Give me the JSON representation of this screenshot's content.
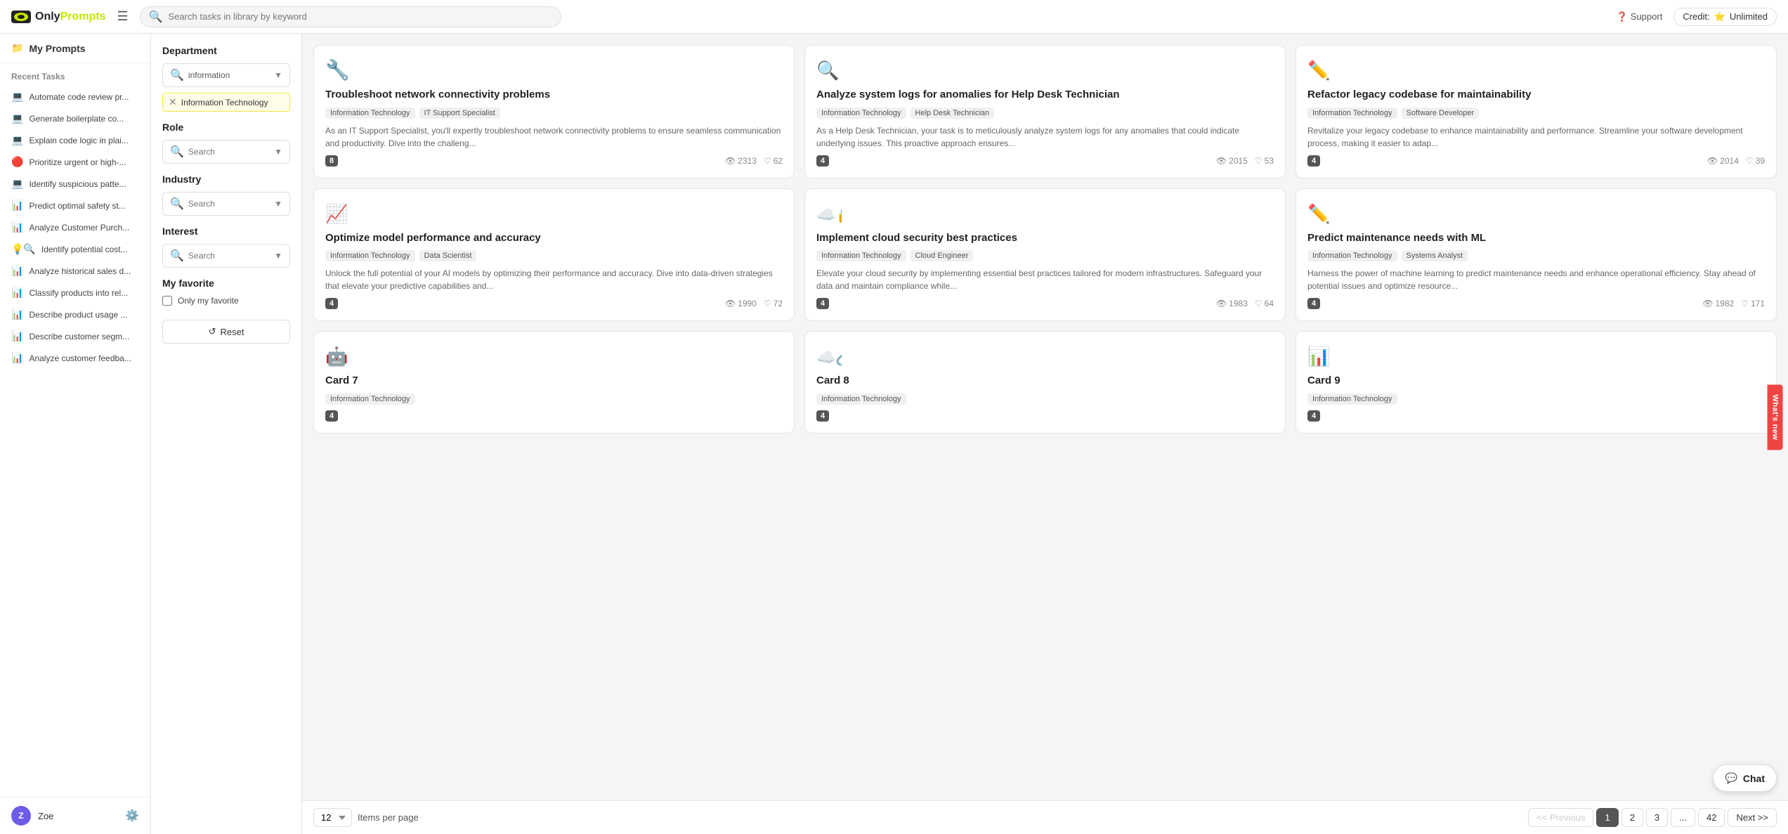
{
  "header": {
    "logo_text_1": "Only",
    "logo_text_2": "Prompts",
    "hamburger_label": "☰",
    "search_placeholder": "Search tasks in library by keyword",
    "support_label": "Support",
    "credit_label": "Credit:",
    "credit_value": "Unlimited"
  },
  "sidebar": {
    "my_prompts_label": "My Prompts",
    "recent_tasks_title": "Recent Tasks",
    "items": [
      {
        "label": "Automate code review pr...",
        "icon": "💻"
      },
      {
        "label": "Generate boilerplate co...",
        "icon": "💻"
      },
      {
        "label": "Explain code logic in plai...",
        "icon": "💻"
      },
      {
        "label": "Prioritize urgent or high-...",
        "icon": "🔴"
      },
      {
        "label": "Identify suspicious patte...",
        "icon": "💻"
      },
      {
        "label": "Predict optimal safety st...",
        "icon": "📊"
      },
      {
        "label": "Analyze Customer Purch...",
        "icon": "📊"
      },
      {
        "label": "Identify potential cost...",
        "icon": "💡🔍"
      },
      {
        "label": "Analyze historical sales d...",
        "icon": "📊"
      },
      {
        "label": "Classify products into rel...",
        "icon": "📊"
      },
      {
        "label": "Describe product usage ...",
        "icon": "📊"
      },
      {
        "label": "Describe customer segm...",
        "icon": "📊"
      },
      {
        "label": "Analyze customer feedba...",
        "icon": "📊"
      }
    ],
    "user_name": "Zoe",
    "user_avatar": "Z"
  },
  "filters": {
    "department_title": "Department",
    "department_search_placeholder": "information",
    "department_tag": "Information Technology",
    "role_title": "Role",
    "role_search_placeholder": "Search",
    "industry_title": "Industry",
    "industry_search_placeholder": "Search",
    "interest_title": "Interest",
    "interest_search_placeholder": "Search",
    "my_favorite_title": "My favorite",
    "my_favorite_checkbox": "Only my favorite",
    "reset_label": "Reset"
  },
  "cards": [
    {
      "id": 1,
      "icon": "🔧",
      "title": "Troubleshoot network connectivity problems",
      "tags": [
        "Information Technology",
        "IT Support Specialist"
      ],
      "description": "As an IT Support Specialist, you'll expertly troubleshoot network connectivity problems to ensure seamless communication and productivity. Dive into the challeng...",
      "badge": "8",
      "views": "2313",
      "likes": "62"
    },
    {
      "id": 2,
      "icon": "🔍",
      "title": "Analyze system logs for anomalies for Help Desk Technician",
      "tags": [
        "Information Technology",
        "Help Desk Technician"
      ],
      "description": "As a Help Desk Technician, your task is to meticulously analyze system logs for any anomalies that could indicate underlying issues. This proactive approach ensures...",
      "badge": "4",
      "views": "2015",
      "likes": "53"
    },
    {
      "id": 3,
      "icon": "✏️",
      "title": "Refactor legacy codebase for maintainability",
      "tags": [
        "Information Technology",
        "Software Developer"
      ],
      "description": "Revitalize your legacy codebase to enhance maintainability and performance. Streamline your software development process, making it easier to adap...",
      "badge": "4",
      "views": "2014",
      "likes": "39"
    },
    {
      "id": 4,
      "icon": "📈",
      "title": "Optimize model performance and accuracy",
      "tags": [
        "Information Technology",
        "Data Scientist"
      ],
      "description": "Unlock the full potential of your AI models by optimizing their performance and accuracy. Dive into data-driven strategies that elevate your predictive capabilities and...",
      "badge": "4",
      "views": "1990",
      "likes": "72"
    },
    {
      "id": 5,
      "icon": "☁️🔒",
      "title": "Implement cloud security best practices",
      "tags": [
        "Information Technology",
        "Cloud Engineer"
      ],
      "description": "Elevate your cloud security by implementing essential best practices tailored for modern infrastructures. Safeguard your data and maintain compliance while...",
      "badge": "4",
      "views": "1983",
      "likes": "64"
    },
    {
      "id": 6,
      "icon": "✏️",
      "title": "Predict maintenance needs with ML",
      "tags": [
        "Information Technology",
        "Systems Analyst"
      ],
      "description": "Harness the power of machine learning to predict maintenance needs and enhance operational efficiency. Stay ahead of potential issues and optimize resource...",
      "badge": "4",
      "views": "1982",
      "likes": "171"
    },
    {
      "id": 7,
      "icon": "🤖",
      "title": "Card 7",
      "tags": [
        "Information Technology"
      ],
      "description": "",
      "badge": "4",
      "views": "",
      "likes": ""
    },
    {
      "id": 8,
      "icon": "☁️🔗",
      "title": "Card 8",
      "tags": [
        "Information Technology"
      ],
      "description": "",
      "badge": "4",
      "views": "",
      "likes": ""
    },
    {
      "id": 9,
      "icon": "📊",
      "title": "Card 9",
      "tags": [
        "Information Technology"
      ],
      "description": "",
      "badge": "4",
      "views": "",
      "likes": ""
    }
  ],
  "pagination": {
    "per_page_value": "12",
    "items_per_page_label": "Items per page",
    "prev_label": "<< Previous",
    "next_label": "Next >>",
    "pages": [
      "1",
      "2",
      "3",
      "...",
      "42"
    ],
    "active_page": "1"
  },
  "chat": {
    "label": "Chat"
  },
  "whats_new": {
    "label": "What's new"
  }
}
